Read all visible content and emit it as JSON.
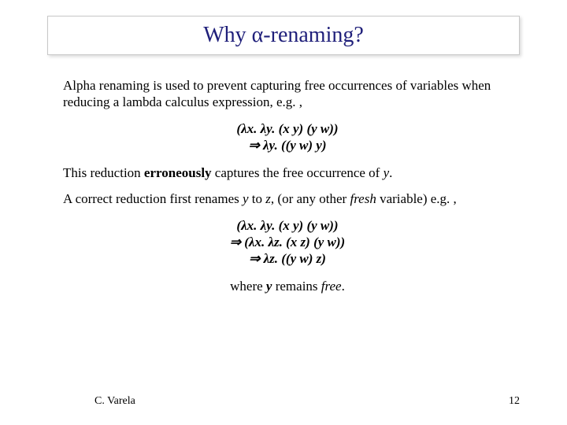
{
  "title": "Why α-renaming?",
  "p1": "Alpha renaming is used to prevent capturing free occurrences of variables when reducing a lambda calculus expression, e.g. ,",
  "f1_line1": "(λx. λy. (x y) (y w))",
  "f1_line2": "⇒ λy. ((y w) y)",
  "p2_pre": "This reduction ",
  "p2_bold": "erroneously",
  "p2_post": " captures the free occurrence of ",
  "p2_y": "y",
  "p2_end": ".",
  "p3_pre": "A correct reduction first renames ",
  "p3_y": "y",
  "p3_to": " to ",
  "p3_z": "z",
  "p3_mid": ", (or any other ",
  "p3_fresh": "fresh",
  "p3_post": " variable) e.g. ,",
  "f2_line1": "(λx. λy. (x y) (y w))",
  "f2_line2": "⇒ (λx. λz. (x z) (y w))",
  "f2_line3": "⇒ λz. ((y w) z)",
  "where_pre": "where ",
  "where_y": "y",
  "where_mid": " remains ",
  "where_free": "free",
  "where_end": ".",
  "footer_author": "C. Varela",
  "footer_page": "12"
}
